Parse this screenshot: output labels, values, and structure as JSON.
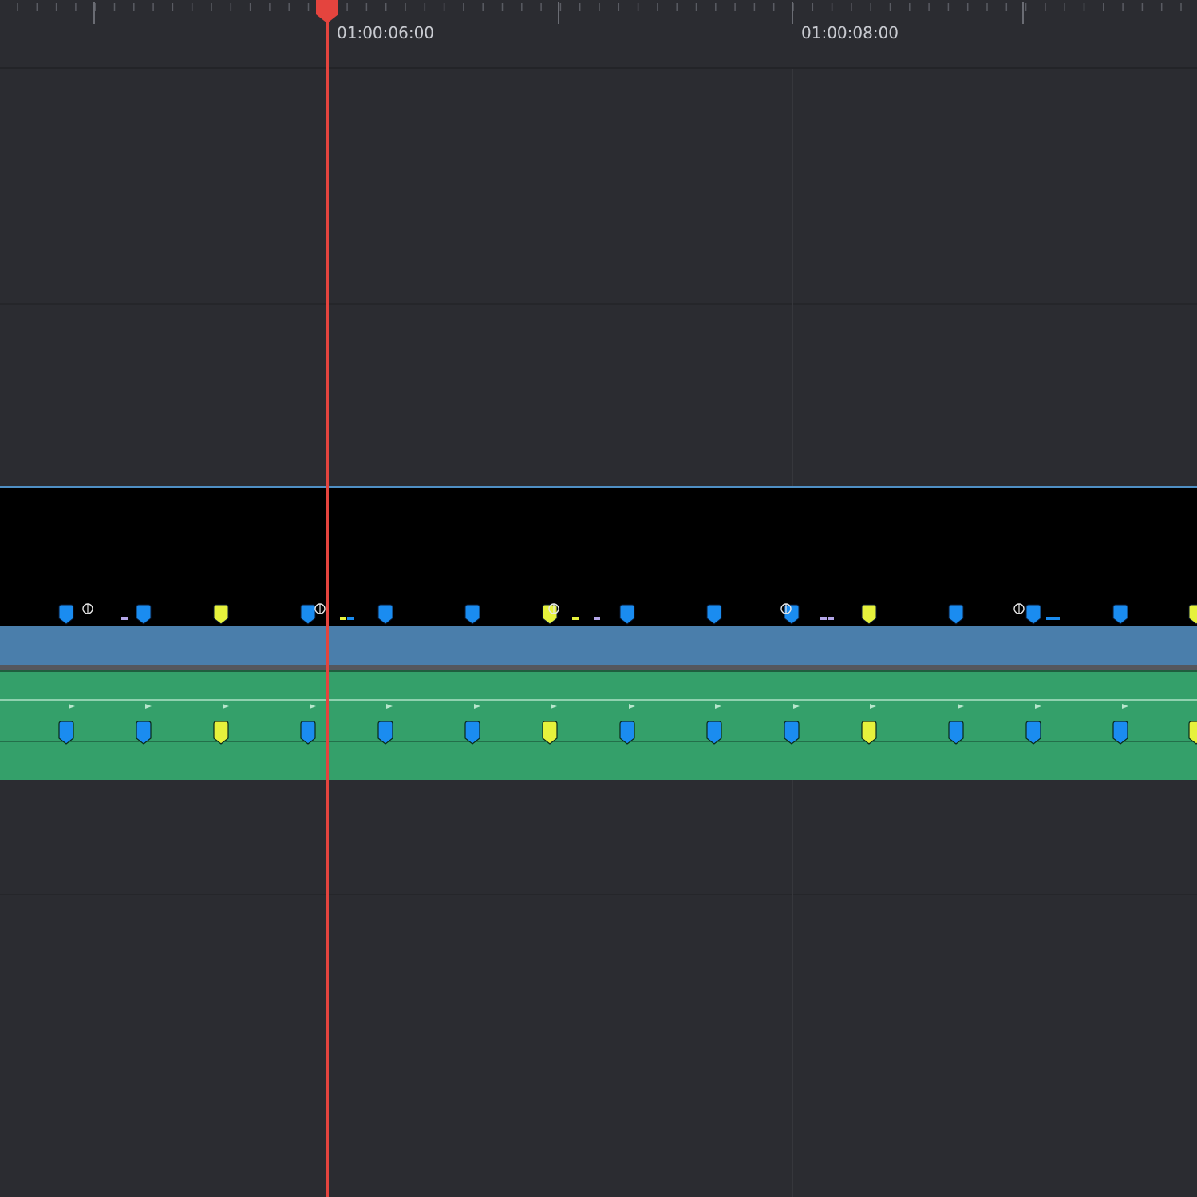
{
  "ruler": {
    "timecodes": [
      "01:00:06:00",
      "01:00:08:00"
    ]
  },
  "colors": {
    "background": "#2b2c31",
    "playhead": "#e4443e",
    "video_clip": "#4a7eab",
    "audio_clip": "#34a06a",
    "marker_blue": "#1a8cf0",
    "marker_yellow": "#e6f23c"
  },
  "video_clip": {
    "markers": [
      {
        "color": "blue",
        "icon": "marker-icon"
      },
      {
        "color": "blue",
        "icon": "marker-icon"
      },
      {
        "color": "yellow",
        "icon": "marker-icon"
      },
      {
        "color": "blue",
        "icon": "marker-icon"
      },
      {
        "color": "blue",
        "icon": "marker-icon"
      },
      {
        "color": "blue",
        "icon": "marker-icon"
      },
      {
        "color": "yellow",
        "icon": "marker-icon"
      },
      {
        "color": "blue",
        "icon": "marker-icon"
      },
      {
        "color": "blue",
        "icon": "marker-icon"
      },
      {
        "color": "blue",
        "icon": "marker-icon"
      },
      {
        "color": "yellow",
        "icon": "marker-icon"
      },
      {
        "color": "blue",
        "icon": "marker-icon"
      },
      {
        "color": "blue",
        "icon": "marker-icon"
      },
      {
        "color": "blue",
        "icon": "marker-icon"
      },
      {
        "color": "yellow",
        "icon": "marker-icon"
      }
    ],
    "effect_icons": [
      "fx-icon",
      "fx-icon",
      "fx-icon",
      "fx-icon",
      "fx-icon"
    ]
  },
  "audio_clip": {
    "markers": [
      {
        "color": "blue",
        "icon": "marker-icon"
      },
      {
        "color": "blue",
        "icon": "marker-icon"
      },
      {
        "color": "yellow",
        "icon": "marker-icon"
      },
      {
        "color": "blue",
        "icon": "marker-icon"
      },
      {
        "color": "blue",
        "icon": "marker-icon"
      },
      {
        "color": "blue",
        "icon": "marker-icon"
      },
      {
        "color": "yellow",
        "icon": "marker-icon"
      },
      {
        "color": "blue",
        "icon": "marker-icon"
      },
      {
        "color": "blue",
        "icon": "marker-icon"
      },
      {
        "color": "blue",
        "icon": "marker-icon"
      },
      {
        "color": "yellow",
        "icon": "marker-icon"
      },
      {
        "color": "blue",
        "icon": "marker-icon"
      },
      {
        "color": "blue",
        "icon": "marker-icon"
      },
      {
        "color": "blue",
        "icon": "marker-icon"
      },
      {
        "color": "yellow",
        "icon": "marker-icon"
      }
    ]
  }
}
